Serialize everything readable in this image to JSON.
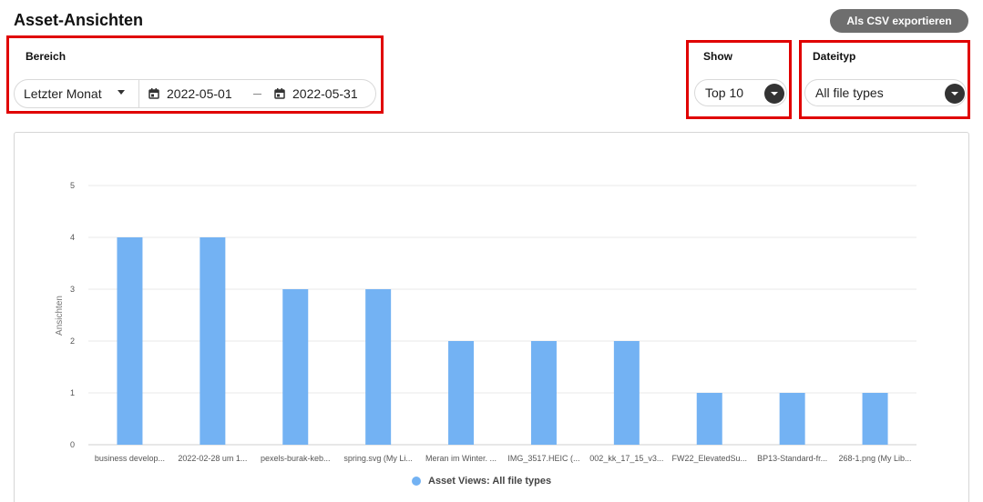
{
  "page": {
    "title": "Asset-Ansichten"
  },
  "toolbar": {
    "export_label": "Als CSV exportieren"
  },
  "filters": {
    "range": {
      "label": "Bereich",
      "preset": "Letzter Monat",
      "start_date": "2022-05-01",
      "end_date": "2022-05-31"
    },
    "show": {
      "label": "Show",
      "value": "Top 10"
    },
    "file_type": {
      "label": "Dateityp",
      "value": "All file types"
    }
  },
  "colors": {
    "bar": "#73b2f3",
    "highlight": "#e00000",
    "button": "#6e6e6e"
  },
  "icons": {
    "calendar": "calendar-icon",
    "dropdown": "chevron-down-icon"
  },
  "chart_data": {
    "type": "bar",
    "categories": [
      "business develop...",
      "2022-02-28 um 1...",
      "pexels-burak-keb...",
      "spring.svg (My Li...",
      "Meran im Winter. ...",
      "IMG_3517.HEIC (...",
      "002_kk_17_15_v3...",
      "FW22_ElevatedSu...",
      "BP13-Standard-fr...",
      "268-1.png (My Lib..."
    ],
    "series": [
      {
        "name": "Asset Views: All file types",
        "values": [
          4,
          4,
          3,
          3,
          2,
          2,
          2,
          1,
          1,
          1
        ]
      }
    ],
    "ylabel": "Ansichten",
    "xlabel": "",
    "ylim": [
      0,
      5
    ],
    "yticks": [
      0,
      1,
      2,
      3,
      4,
      5
    ],
    "grid": true,
    "legend_position": "bottom"
  }
}
